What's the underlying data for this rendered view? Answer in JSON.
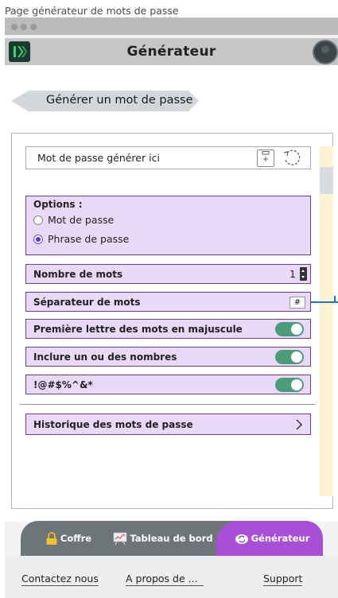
{
  "page_caption": "Page générateur de mots de passe",
  "header": {
    "title": "Générateur"
  },
  "back_button": {
    "label": "Générer un mot de passe"
  },
  "password_field": {
    "value": "Mot de passe générer ici"
  },
  "options": {
    "title": "Options :",
    "choices": [
      {
        "label": "Mot de passe",
        "selected": false
      },
      {
        "label": "Phrase de passe",
        "selected": true
      }
    ]
  },
  "word_count": {
    "label": "Nombre de mots",
    "value": "1"
  },
  "separator": {
    "label": "Séparateur de mots",
    "value": "#"
  },
  "toggles": [
    {
      "label": "Première lettre des mots en majuscule",
      "on": true
    },
    {
      "label": "Inclure un ou des nombres",
      "on": true
    },
    {
      "label": "!@#$%^&*",
      "on": true
    }
  ],
  "history": {
    "label": "Historique des mots de passe"
  },
  "nav": {
    "items": [
      {
        "label": "Coffre",
        "icon": "lock-icon"
      },
      {
        "label": "Tableau de bord",
        "icon": "dashboard-icon"
      },
      {
        "label": "Générateur",
        "icon": "refresh-icon",
        "active": true
      }
    ]
  },
  "footer": {
    "contact": "Contactez nous",
    "about": "A propos de ...",
    "support": "Support"
  },
  "colors": {
    "option_bg": "#ead8f7",
    "option_border": "#6b3f8f",
    "toggle_on": "#4b9c7c",
    "nav_bg": "#6e7579",
    "nav_active": "#a94fd6"
  }
}
